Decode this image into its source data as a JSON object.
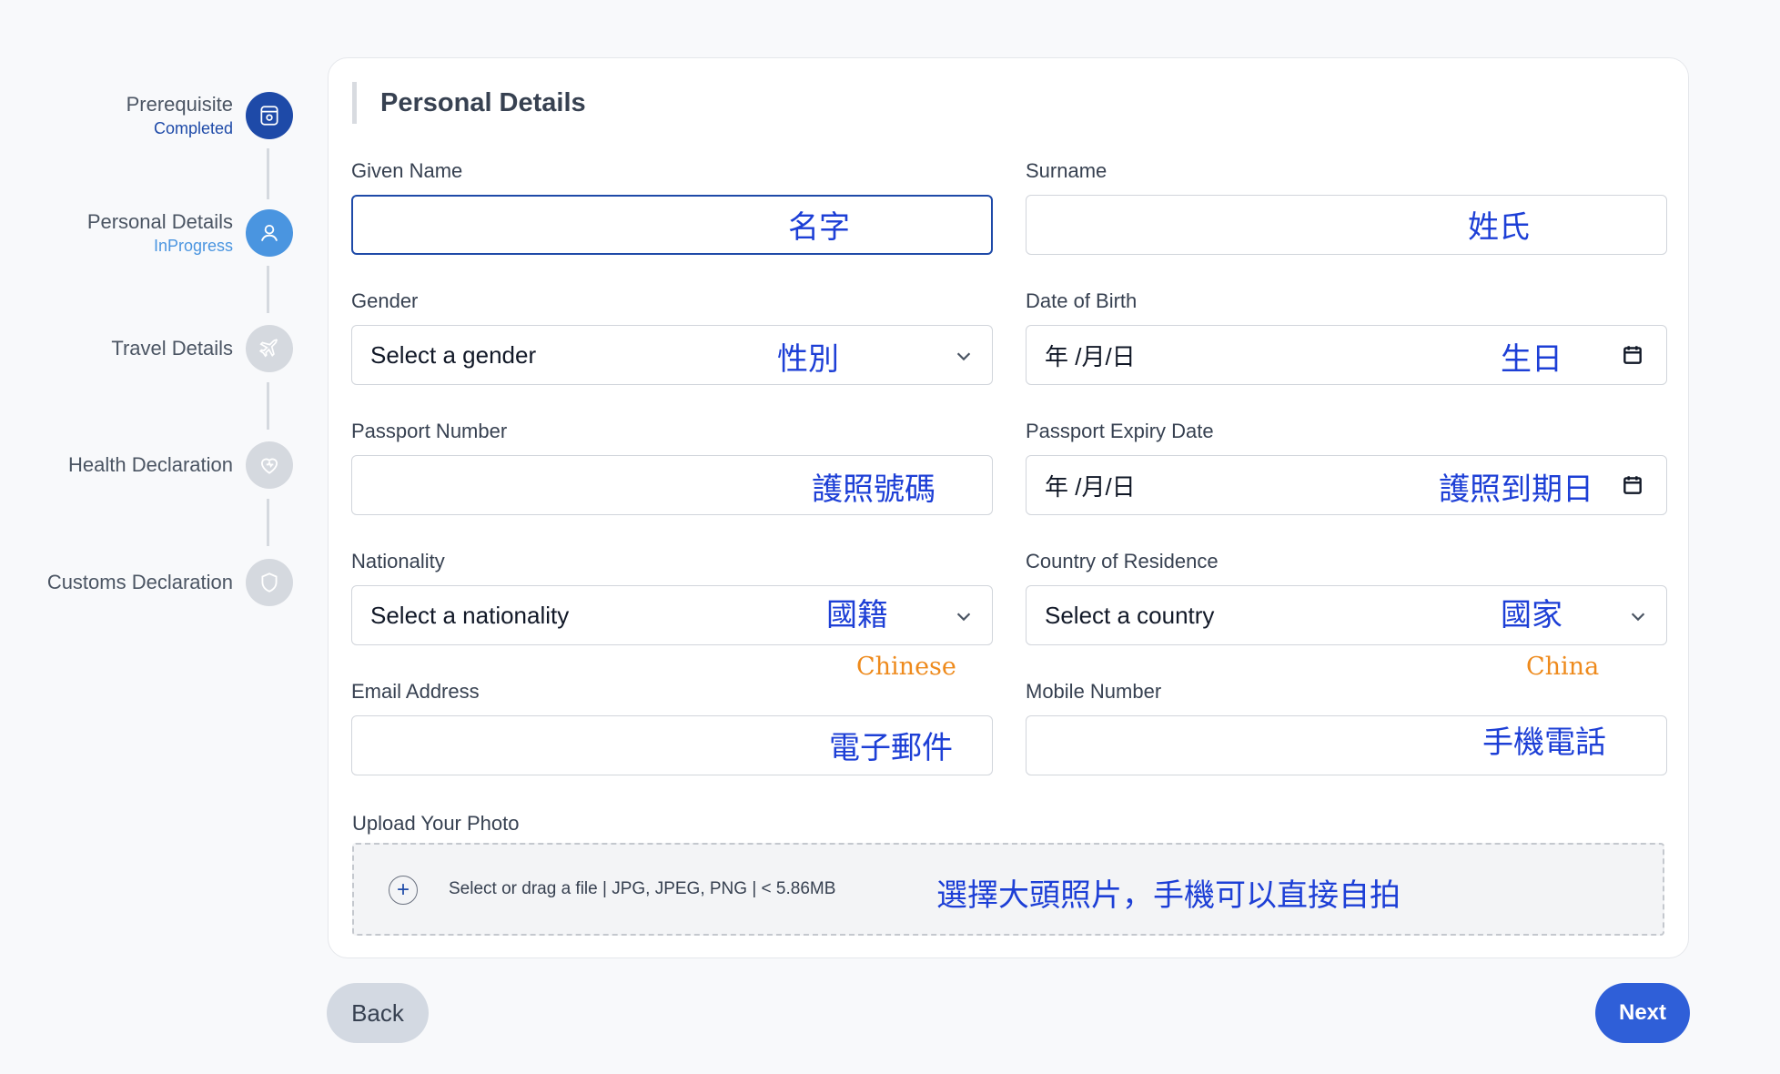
{
  "stepper": {
    "steps": [
      {
        "label": "Prerequisite",
        "status": "Completed",
        "state": "done",
        "icon": "document-icon"
      },
      {
        "label": "Personal Details",
        "status": "InProgress",
        "state": "progress",
        "icon": "user-icon"
      },
      {
        "label": "Travel Details",
        "status": "",
        "state": "pending",
        "icon": "plane-icon"
      },
      {
        "label": "Health Declaration",
        "status": "",
        "state": "pending",
        "icon": "heart-icon"
      },
      {
        "label": "Customs Declaration",
        "status": "",
        "state": "pending",
        "icon": "shield-icon"
      }
    ]
  },
  "form": {
    "title": "Personal Details",
    "given_name": {
      "label": "Given Name",
      "value": "",
      "annotation": "名字"
    },
    "surname": {
      "label": "Surname",
      "value": "",
      "annotation": "姓氏"
    },
    "gender": {
      "label": "Gender",
      "value": "Select a gender",
      "annotation": "性別"
    },
    "dob": {
      "label": "Date of Birth",
      "value": "年 /月/日",
      "annotation": "生日"
    },
    "passport_number": {
      "label": "Passport Number",
      "value": "",
      "annotation": "護照號碼"
    },
    "passport_expiry": {
      "label": "Passport Expiry Date",
      "value": "年 /月/日",
      "annotation": "護照到期日"
    },
    "nationality": {
      "label": "Nationality",
      "value": "Select a nationality",
      "annotation": "國籍",
      "note": "Chinese"
    },
    "country": {
      "label": "Country of Residence",
      "value": "Select a country",
      "annotation": "國家",
      "note": "China"
    },
    "email": {
      "label": "Email Address",
      "value": "",
      "annotation": "電子郵件"
    },
    "mobile": {
      "label": "Mobile Number",
      "value": "",
      "annotation": "手機電話"
    },
    "upload": {
      "label": "Upload Your Photo",
      "hint": "Select or drag a file | JPG, JPEG, PNG | < 5.86MB",
      "annotation": "選擇大頭照片，手機可以直接自拍"
    }
  },
  "buttons": {
    "back": "Back",
    "next": "Next"
  },
  "colors": {
    "primary": "#1e4aa8",
    "in_progress": "#4a95e0",
    "pending": "#d5d9df",
    "annotation": "#1d3fd6",
    "note": "#ee8a1c"
  }
}
